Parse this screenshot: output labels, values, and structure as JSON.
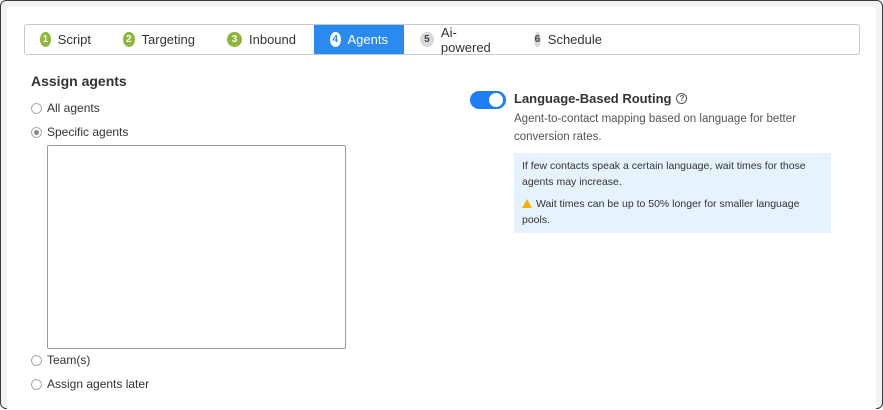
{
  "stepper": {
    "steps": [
      {
        "number": "1",
        "label": "Script",
        "state": "done"
      },
      {
        "number": "2",
        "label": "Targeting",
        "state": "done"
      },
      {
        "number": "3",
        "label": "Inbound",
        "state": "done"
      },
      {
        "number": "4",
        "label": "Agents",
        "state": "active"
      },
      {
        "number": "5",
        "label": "Ai-powered",
        "state": "todo"
      },
      {
        "number": "6",
        "label": "Schedule",
        "state": "todo"
      }
    ],
    "colors": {
      "done": "#8db63c",
      "active": "#2a8af0",
      "todo": "#d8d8d8"
    }
  },
  "assign": {
    "title": "Assign agents",
    "options": [
      {
        "label": "All agents",
        "checked": false
      },
      {
        "label": "Specific agents",
        "checked": true
      },
      {
        "label": "Team(s)",
        "checked": false
      },
      {
        "label": "Assign agents later",
        "checked": false
      }
    ]
  },
  "routing": {
    "toggle_on": true,
    "title": "Language-Based Routing",
    "description": "Agent-to-contact mapping based on language for better conversion rates.",
    "info_text": "If few contacts speak a certain language, wait times for those agents may increase.",
    "warning_text": "Wait times can be up to 50% longer for smaller language pools.",
    "accent_color": "#1f7ef5"
  }
}
